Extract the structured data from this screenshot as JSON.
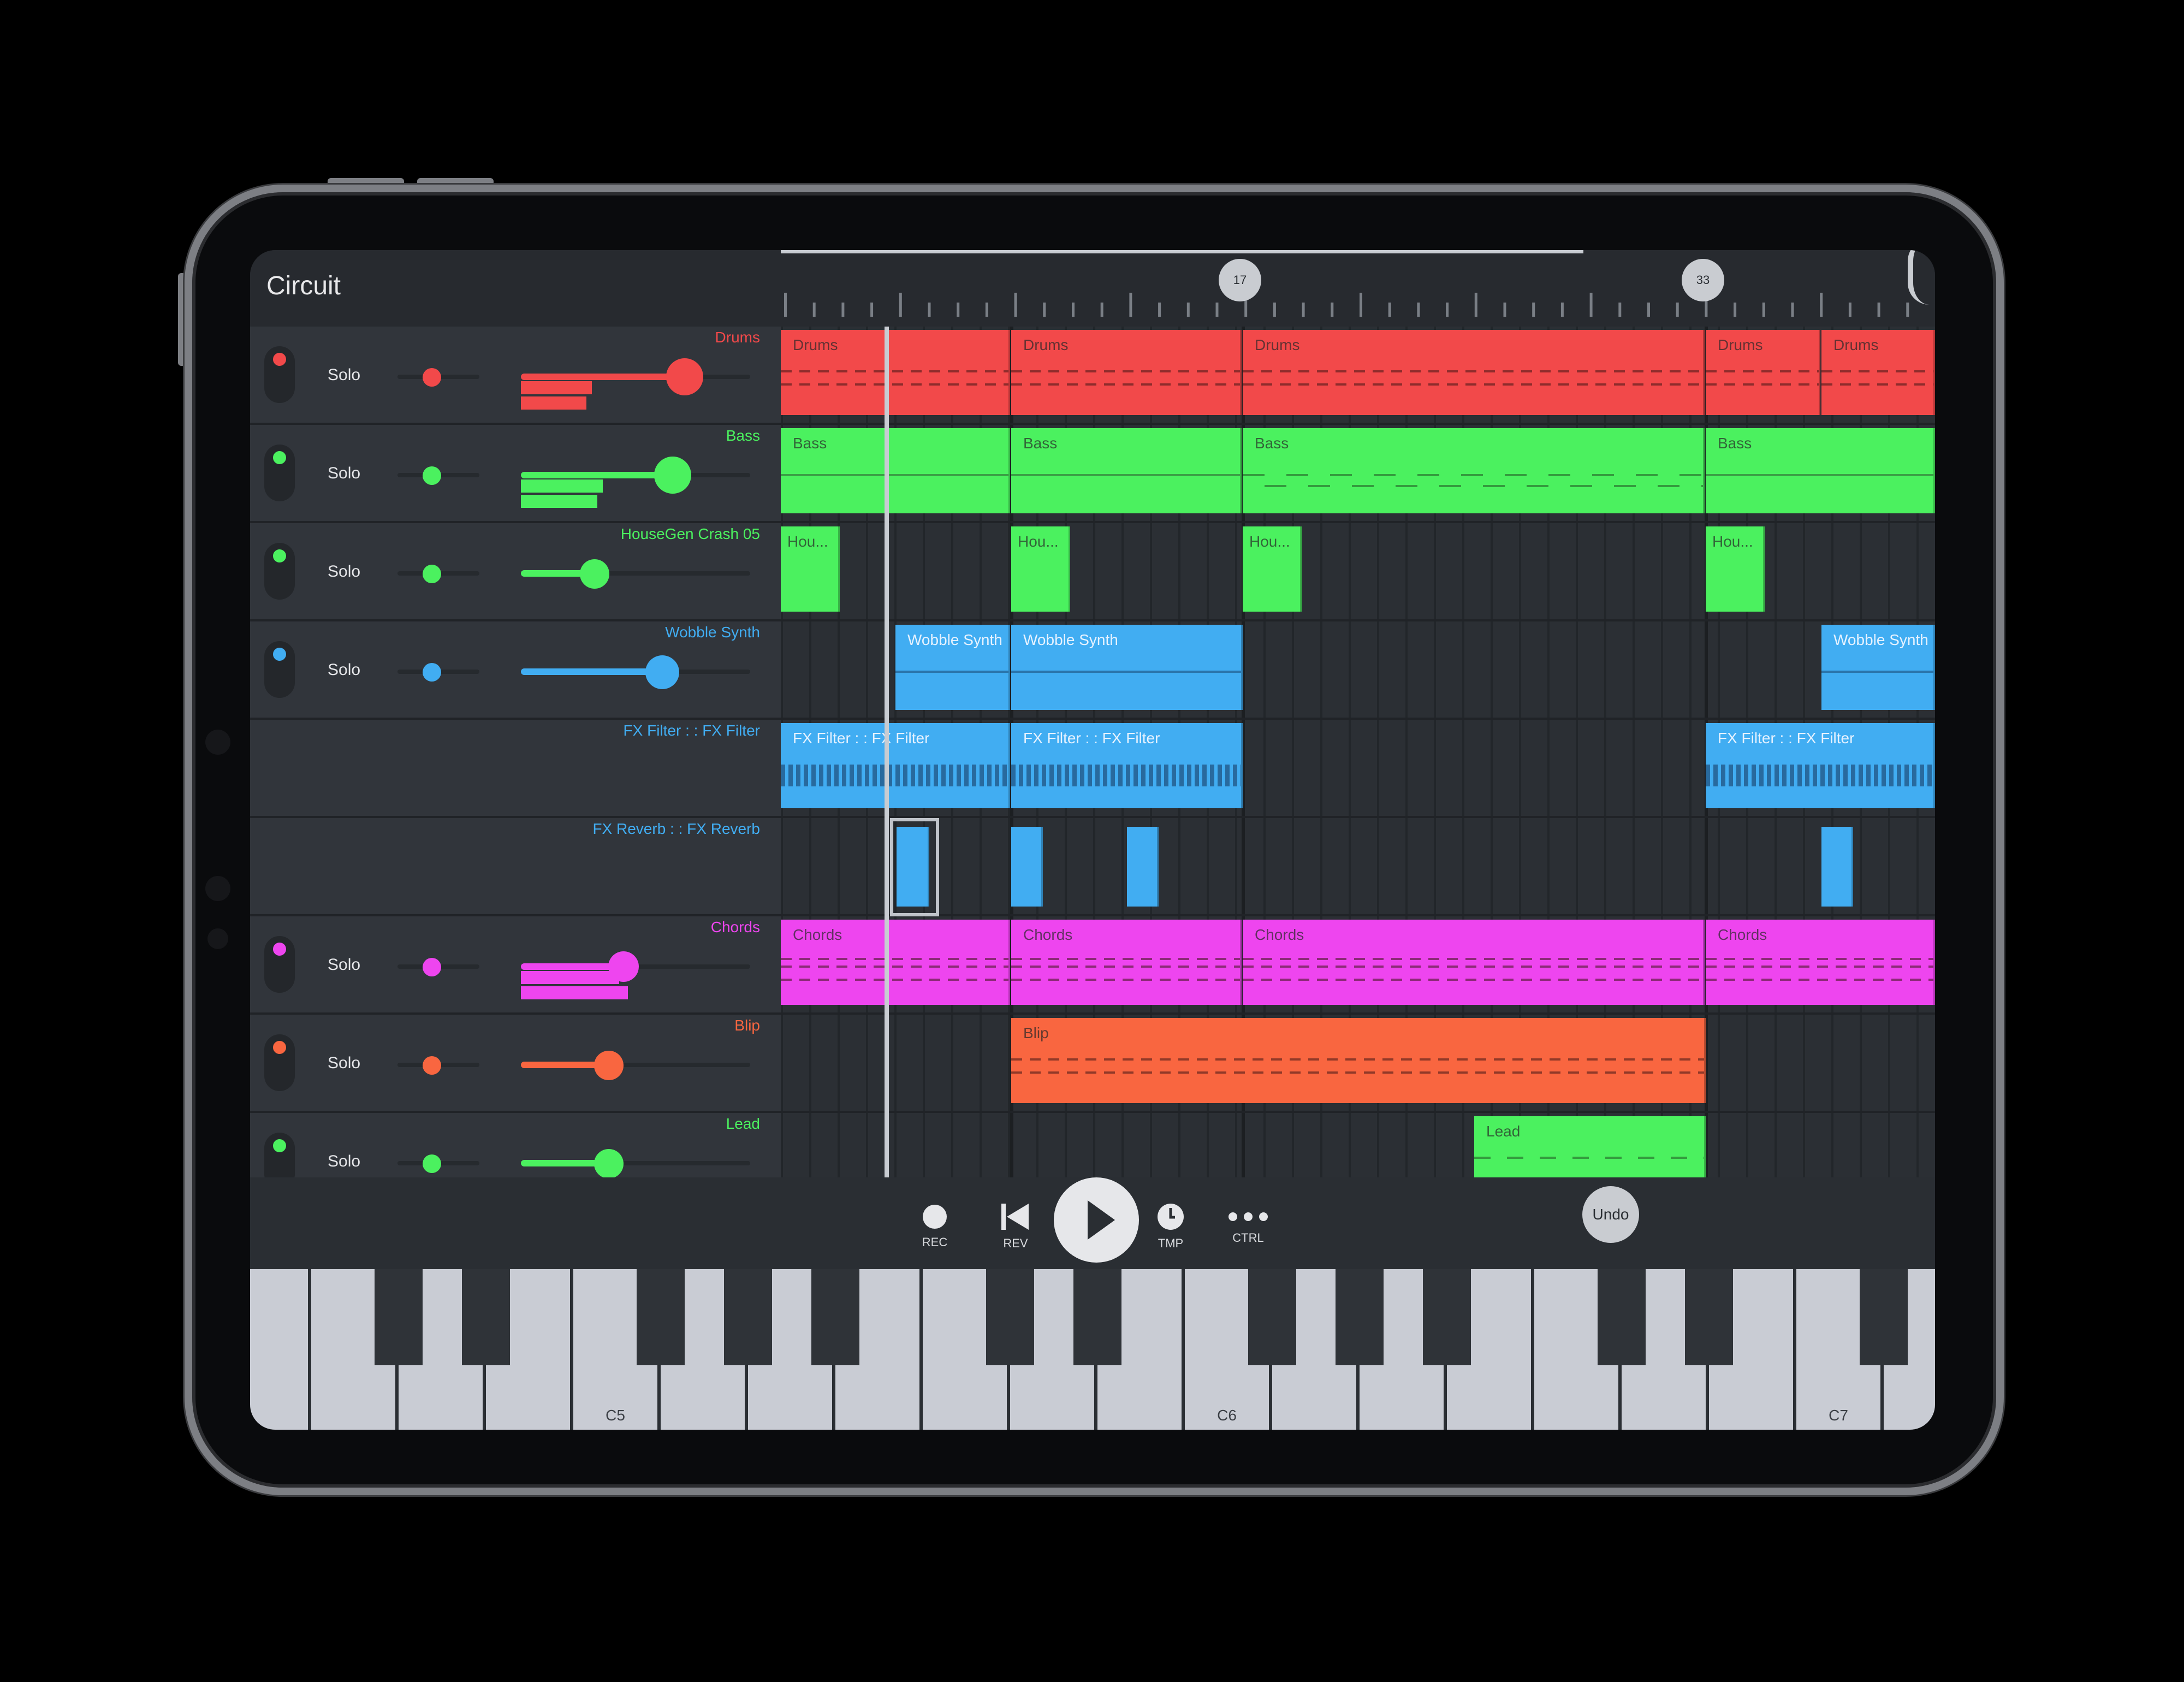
{
  "app": {
    "title": "Circuit"
  },
  "timeline": {
    "markers": [
      "17",
      "33"
    ]
  },
  "colors": {
    "red": "#f2494a",
    "green": "#4bf15f",
    "blue": "#41adf2",
    "magenta": "#ee45ef",
    "orange": "#f96640"
  },
  "tracks": [
    {
      "name": "Drums",
      "solo_label": "Solo",
      "color": "#f2494a",
      "volume": 0.74
    },
    {
      "name": "Bass",
      "solo_label": "Solo",
      "color": "#4bf15f",
      "volume": 0.7
    },
    {
      "name": "HouseGen Crash 05",
      "solo_label": "Solo",
      "color": "#4bf15f",
      "volume": 0.34
    },
    {
      "name": "Wobble Synth",
      "solo_label": "Solo",
      "color": "#41adf2",
      "volume": 0.62
    },
    {
      "name": "FX Filter : : FX Filter",
      "color": "#41adf2"
    },
    {
      "name": "FX Reverb : : FX Reverb",
      "color": "#41adf2"
    },
    {
      "name": "Chords",
      "solo_label": "Solo",
      "color": "#ee45ef",
      "volume": 0.5
    },
    {
      "name": "Blip",
      "solo_label": "Solo",
      "color": "#f96640",
      "volume": 0.4
    },
    {
      "name": "Lead",
      "solo_label": "Solo",
      "color": "#4bf15f",
      "volume": 0.4
    }
  ],
  "clips": {
    "drums": [
      "Drums",
      "Drums",
      "Drums",
      "Drums",
      "Drums"
    ],
    "bass": [
      "Bass",
      "Bass",
      "Bass",
      "Bass"
    ],
    "crash": [
      "Hou...",
      "Hou...",
      "Hou...",
      "Hou..."
    ],
    "wobble": [
      "Wobble Synth",
      "Wobble Synth",
      "Wobble Synth"
    ],
    "filter": [
      "FX Filter :  : FX Filter",
      "FX Filter :  : FX Filter",
      "FX Filter :  : FX Filter"
    ],
    "chords": [
      "Chords",
      "Chords",
      "Chords",
      "Chords"
    ],
    "blip": [
      "Blip"
    ],
    "lead": [
      "Lead"
    ]
  },
  "transport": {
    "rec": "REC",
    "rev": "REV",
    "tmp": "TMP",
    "ctrl": "CTRL",
    "undo": "Undo"
  },
  "keyboard": {
    "labels": [
      "C5",
      "C6",
      "C7"
    ]
  }
}
